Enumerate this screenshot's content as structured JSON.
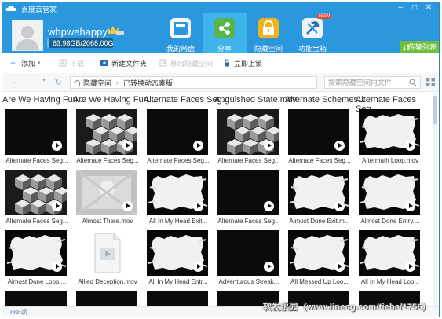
{
  "app": {
    "title": "百度云管家",
    "minimize": "–",
    "maximize": "□",
    "close": "✕"
  },
  "user": {
    "name": "whpwehappy",
    "quota": "63.98GB/2068.00GB",
    "quota_fraction": 0.031
  },
  "nav": [
    {
      "label": "我的网盘",
      "icon": "cloud-drive-icon",
      "active": false
    },
    {
      "label": "分享",
      "icon": "share-icon",
      "active": true
    },
    {
      "label": "隐藏空间",
      "icon": "lock-icon",
      "active": false
    },
    {
      "label": "功能宝箱",
      "icon": "toolbox-icon",
      "active": false,
      "badge": "NEW"
    }
  ],
  "transfer_list": "传输列表",
  "toolbar": {
    "add": "添加",
    "download": "下载",
    "new_folder": "新建文件夹",
    "move_out": "移出隐藏空间",
    "lock_now": "立即上锁"
  },
  "address": {
    "crumb_root": "隐藏空间",
    "crumb_current": "已转换动态素版",
    "search_placeholder": "搜索隐藏空间内文件"
  },
  "files": {
    "top_names": [
      "Are We Having Fun...",
      "Are We Having Fun...",
      "Alternate Faces Seg...",
      "Anguished State.mov",
      "Alternate Schemes...",
      "Alternate Faces Seg..."
    ],
    "rows": [
      [
        {
          "name": "Alternate Faces Seg...",
          "style": "dark"
        },
        {
          "name": "Alternate Faces Seg...",
          "style": "cubes"
        },
        {
          "name": "Alternate Faces Seg...",
          "style": "dark"
        },
        {
          "name": "Alternate Faces Seg...",
          "style": "cubes"
        },
        {
          "name": "Alternate Faces Seg...",
          "style": "dark"
        },
        {
          "name": "Aftermath Loop.mov",
          "style": "brush"
        }
      ],
      [
        {
          "name": "Alternate Faces Seg...",
          "style": "cubes"
        },
        {
          "name": "Almost There.mov",
          "style": "grunge"
        },
        {
          "name": "All In My Head Exit...",
          "style": "brush"
        },
        {
          "name": "Alternate Faces Seg...",
          "style": "dark"
        },
        {
          "name": "Almost Done Exit.m...",
          "style": "brush"
        },
        {
          "name": "Almost Done Entry....",
          "style": "brush"
        }
      ],
      [
        {
          "name": "Almost Done Loop....",
          "style": "brush"
        },
        {
          "name": "Allied Deception.mov",
          "style": "file"
        },
        {
          "name": "All In My Head Entr...",
          "style": "brush"
        },
        {
          "name": "Adventurous Streak...",
          "style": "dark"
        },
        {
          "name": "All Messed Up Loo...",
          "style": "brush"
        },
        {
          "name": "All In My Head Loo...",
          "style": "brush"
        }
      ]
    ]
  },
  "status": {
    "count": "888项",
    "watermark": "软发乐园（www.linecg.com/tieba/1756）"
  }
}
